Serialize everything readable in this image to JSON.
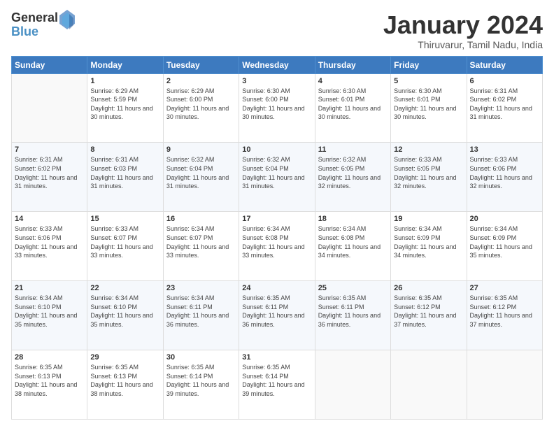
{
  "header": {
    "logo": {
      "general": "General",
      "blue": "Blue"
    },
    "title": "January 2024",
    "subtitle": "Thiruvarur, Tamil Nadu, India"
  },
  "calendar": {
    "headers": [
      "Sunday",
      "Monday",
      "Tuesday",
      "Wednesday",
      "Thursday",
      "Friday",
      "Saturday"
    ],
    "weeks": [
      [
        {
          "day": "",
          "sunrise": "",
          "sunset": "",
          "daylight": "",
          "empty": true
        },
        {
          "day": "1",
          "sunrise": "Sunrise: 6:29 AM",
          "sunset": "Sunset: 5:59 PM",
          "daylight": "Daylight: 11 hours and 30 minutes."
        },
        {
          "day": "2",
          "sunrise": "Sunrise: 6:29 AM",
          "sunset": "Sunset: 6:00 PM",
          "daylight": "Daylight: 11 hours and 30 minutes."
        },
        {
          "day": "3",
          "sunrise": "Sunrise: 6:30 AM",
          "sunset": "Sunset: 6:00 PM",
          "daylight": "Daylight: 11 hours and 30 minutes."
        },
        {
          "day": "4",
          "sunrise": "Sunrise: 6:30 AM",
          "sunset": "Sunset: 6:01 PM",
          "daylight": "Daylight: 11 hours and 30 minutes."
        },
        {
          "day": "5",
          "sunrise": "Sunrise: 6:30 AM",
          "sunset": "Sunset: 6:01 PM",
          "daylight": "Daylight: 11 hours and 30 minutes."
        },
        {
          "day": "6",
          "sunrise": "Sunrise: 6:31 AM",
          "sunset": "Sunset: 6:02 PM",
          "daylight": "Daylight: 11 hours and 31 minutes."
        }
      ],
      [
        {
          "day": "7",
          "sunrise": "Sunrise: 6:31 AM",
          "sunset": "Sunset: 6:02 PM",
          "daylight": "Daylight: 11 hours and 31 minutes."
        },
        {
          "day": "8",
          "sunrise": "Sunrise: 6:31 AM",
          "sunset": "Sunset: 6:03 PM",
          "daylight": "Daylight: 11 hours and 31 minutes."
        },
        {
          "day": "9",
          "sunrise": "Sunrise: 6:32 AM",
          "sunset": "Sunset: 6:04 PM",
          "daylight": "Daylight: 11 hours and 31 minutes."
        },
        {
          "day": "10",
          "sunrise": "Sunrise: 6:32 AM",
          "sunset": "Sunset: 6:04 PM",
          "daylight": "Daylight: 11 hours and 31 minutes."
        },
        {
          "day": "11",
          "sunrise": "Sunrise: 6:32 AM",
          "sunset": "Sunset: 6:05 PM",
          "daylight": "Daylight: 11 hours and 32 minutes."
        },
        {
          "day": "12",
          "sunrise": "Sunrise: 6:33 AM",
          "sunset": "Sunset: 6:05 PM",
          "daylight": "Daylight: 11 hours and 32 minutes."
        },
        {
          "day": "13",
          "sunrise": "Sunrise: 6:33 AM",
          "sunset": "Sunset: 6:06 PM",
          "daylight": "Daylight: 11 hours and 32 minutes."
        }
      ],
      [
        {
          "day": "14",
          "sunrise": "Sunrise: 6:33 AM",
          "sunset": "Sunset: 6:06 PM",
          "daylight": "Daylight: 11 hours and 33 minutes."
        },
        {
          "day": "15",
          "sunrise": "Sunrise: 6:33 AM",
          "sunset": "Sunset: 6:07 PM",
          "daylight": "Daylight: 11 hours and 33 minutes."
        },
        {
          "day": "16",
          "sunrise": "Sunrise: 6:34 AM",
          "sunset": "Sunset: 6:07 PM",
          "daylight": "Daylight: 11 hours and 33 minutes."
        },
        {
          "day": "17",
          "sunrise": "Sunrise: 6:34 AM",
          "sunset": "Sunset: 6:08 PM",
          "daylight": "Daylight: 11 hours and 33 minutes."
        },
        {
          "day": "18",
          "sunrise": "Sunrise: 6:34 AM",
          "sunset": "Sunset: 6:08 PM",
          "daylight": "Daylight: 11 hours and 34 minutes."
        },
        {
          "day": "19",
          "sunrise": "Sunrise: 6:34 AM",
          "sunset": "Sunset: 6:09 PM",
          "daylight": "Daylight: 11 hours and 34 minutes."
        },
        {
          "day": "20",
          "sunrise": "Sunrise: 6:34 AM",
          "sunset": "Sunset: 6:09 PM",
          "daylight": "Daylight: 11 hours and 35 minutes."
        }
      ],
      [
        {
          "day": "21",
          "sunrise": "Sunrise: 6:34 AM",
          "sunset": "Sunset: 6:10 PM",
          "daylight": "Daylight: 11 hours and 35 minutes."
        },
        {
          "day": "22",
          "sunrise": "Sunrise: 6:34 AM",
          "sunset": "Sunset: 6:10 PM",
          "daylight": "Daylight: 11 hours and 35 minutes."
        },
        {
          "day": "23",
          "sunrise": "Sunrise: 6:34 AM",
          "sunset": "Sunset: 6:11 PM",
          "daylight": "Daylight: 11 hours and 36 minutes."
        },
        {
          "day": "24",
          "sunrise": "Sunrise: 6:35 AM",
          "sunset": "Sunset: 6:11 PM",
          "daylight": "Daylight: 11 hours and 36 minutes."
        },
        {
          "day": "25",
          "sunrise": "Sunrise: 6:35 AM",
          "sunset": "Sunset: 6:11 PM",
          "daylight": "Daylight: 11 hours and 36 minutes."
        },
        {
          "day": "26",
          "sunrise": "Sunrise: 6:35 AM",
          "sunset": "Sunset: 6:12 PM",
          "daylight": "Daylight: 11 hours and 37 minutes."
        },
        {
          "day": "27",
          "sunrise": "Sunrise: 6:35 AM",
          "sunset": "Sunset: 6:12 PM",
          "daylight": "Daylight: 11 hours and 37 minutes."
        }
      ],
      [
        {
          "day": "28",
          "sunrise": "Sunrise: 6:35 AM",
          "sunset": "Sunset: 6:13 PM",
          "daylight": "Daylight: 11 hours and 38 minutes."
        },
        {
          "day": "29",
          "sunrise": "Sunrise: 6:35 AM",
          "sunset": "Sunset: 6:13 PM",
          "daylight": "Daylight: 11 hours and 38 minutes."
        },
        {
          "day": "30",
          "sunrise": "Sunrise: 6:35 AM",
          "sunset": "Sunset: 6:14 PM",
          "daylight": "Daylight: 11 hours and 39 minutes."
        },
        {
          "day": "31",
          "sunrise": "Sunrise: 6:35 AM",
          "sunset": "Sunset: 6:14 PM",
          "daylight": "Daylight: 11 hours and 39 minutes."
        },
        {
          "day": "",
          "sunrise": "",
          "sunset": "",
          "daylight": "",
          "empty": true
        },
        {
          "day": "",
          "sunrise": "",
          "sunset": "",
          "daylight": "",
          "empty": true
        },
        {
          "day": "",
          "sunrise": "",
          "sunset": "",
          "daylight": "",
          "empty": true
        }
      ]
    ]
  }
}
